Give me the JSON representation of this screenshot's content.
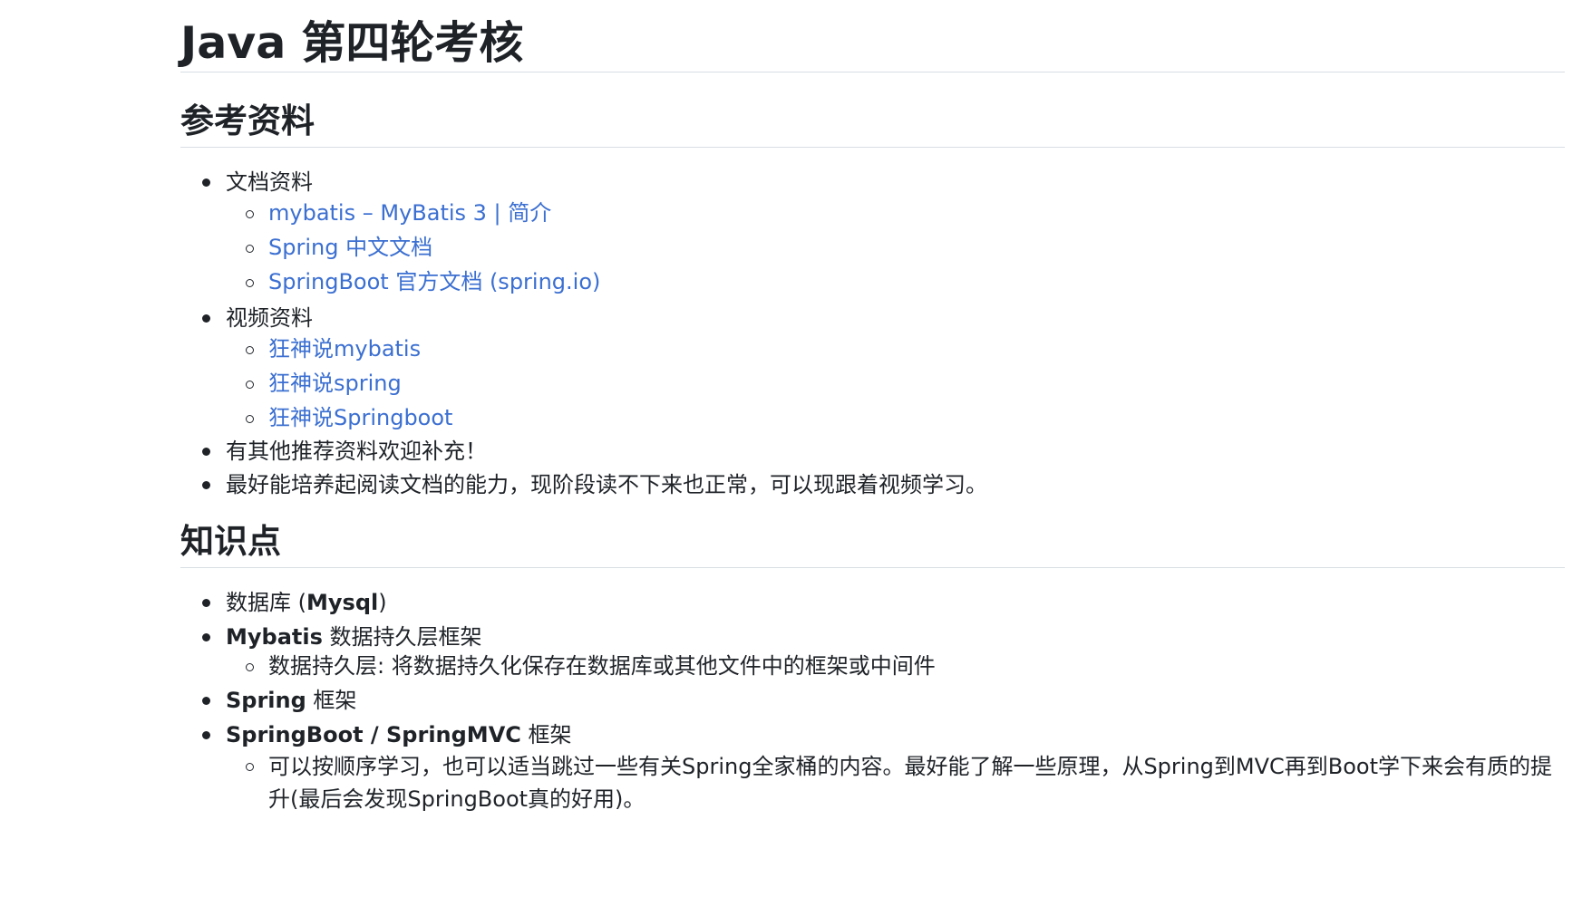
{
  "title": "Java 第四轮考核",
  "sections": {
    "references": {
      "heading": "参考资料",
      "docs": {
        "label": "文档资料",
        "links": [
          "mybatis – MyBatis 3 | 简介",
          "Spring 中文文档",
          "SpringBoot 官方文档 (spring.io)"
        ]
      },
      "videos": {
        "label": "视频资料",
        "links": [
          "狂神说mybatis",
          "狂神说spring",
          "狂神说Springboot"
        ]
      },
      "note1": "有其他推荐资料欢迎补充！",
      "note2": "最好能培养起阅读文档的能力，现阶段读不下来也正常，可以现跟着视频学习。"
    },
    "knowledge": {
      "heading": "知识点",
      "database": {
        "prefix": "数据库 (",
        "bold": "Mysql",
        "suffix": ")"
      },
      "mybatis": {
        "bold": "Mybatis",
        "rest": " 数据持久层框架",
        "sub": "数据持久层: 将数据持久化保存在数据库或其他文件中的框架或中间件"
      },
      "spring": {
        "bold": "Spring",
        "rest": " 框架"
      },
      "springboot": {
        "bold": "SpringBoot / SpringMVC",
        "rest": " 框架",
        "sub": "可以按顺序学习，也可以适当跳过一些有关Spring全家桶的内容。最好能了解一些原理，从Spring到MVC再到Boot学下来会有质的提升(最后会发现SpringBoot真的好用)。"
      }
    }
  },
  "colors": {
    "text": "#1f2328",
    "link": "#3b6fd1",
    "rule": "#d8dee4"
  }
}
